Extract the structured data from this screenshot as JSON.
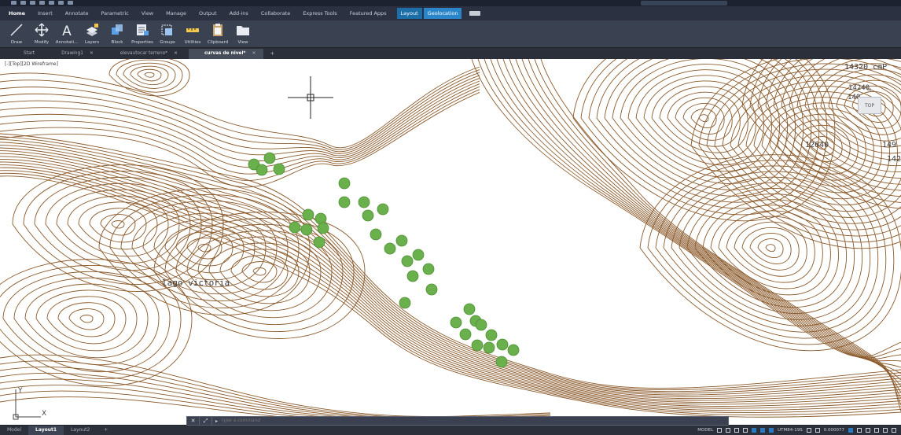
{
  "ribbon": {
    "tabs": [
      {
        "label": "Home",
        "active": true
      },
      {
        "label": "Insert"
      },
      {
        "label": "Annotate"
      },
      {
        "label": "Parametric"
      },
      {
        "label": "View"
      },
      {
        "label": "Manage"
      },
      {
        "label": "Output"
      },
      {
        "label": "Add-ins"
      },
      {
        "label": "Collaborate"
      },
      {
        "label": "Express Tools"
      },
      {
        "label": "Featured Apps"
      },
      {
        "label": "Layout",
        "contextual": true
      },
      {
        "label": "Geolocation",
        "contextual": true
      }
    ],
    "tools": [
      {
        "label": "Draw",
        "icon": "pencil-line-icon"
      },
      {
        "label": "Modify",
        "icon": "move-arrows-icon"
      },
      {
        "label": "Annotati...",
        "icon": "text-a-icon"
      },
      {
        "label": "Layers",
        "icon": "layers-icon"
      },
      {
        "label": "Block",
        "icon": "block-icon"
      },
      {
        "label": "Properties",
        "icon": "properties-icon"
      },
      {
        "label": "Groups",
        "icon": "groups-icon"
      },
      {
        "label": "Utilities",
        "icon": "measure-icon"
      },
      {
        "label": "Clipboard",
        "icon": "clipboard-icon"
      },
      {
        "label": "View",
        "icon": "folder-view-icon"
      }
    ]
  },
  "file_tabs": [
    {
      "label": "Start",
      "closable": false
    },
    {
      "label": "Drawing1",
      "closable": true
    },
    {
      "label": "elevautocar terreno*",
      "closable": true
    },
    {
      "label": "curvas de nivel*",
      "closable": true,
      "active": true
    }
  ],
  "canvas": {
    "viewport_label": "[-][Top][2D Wireframe]",
    "map_labels": [
      {
        "key": "lago",
        "text": "lago victoria"
      },
      {
        "key": "l14320",
        "text": "14320 cmP"
      },
      {
        "key": "l14240",
        "text": "14240"
      },
      {
        "key": "l140",
        "text": "140"
      },
      {
        "key": "l12640",
        "text": "12640"
      },
      {
        "key": "l149",
        "text": "149"
      },
      {
        "key": "l142",
        "text": "142"
      }
    ],
    "viewcube": {
      "north": "N",
      "face": "TOP"
    },
    "ucs": {
      "x_axis": "X",
      "y_axis": "Y"
    }
  },
  "command_line": {
    "placeholder": "Type a command",
    "close_glyph": "✕",
    "tool_glyph": "⤢"
  },
  "status_bar": {
    "layout_tabs": [
      {
        "label": "Model"
      },
      {
        "label": "Layout1",
        "active": true
      },
      {
        "label": "Layout2"
      }
    ],
    "model_label": "MODEL",
    "coord_system": "UTM84-19S",
    "scale": "0.000077"
  },
  "colors": {
    "contour": "#8b5a2b",
    "tree": "#6ab04c",
    "tree_stroke": "#4e8f35",
    "ribbon_bg": "#3a4150",
    "contextual_tab": "#1b6ea8"
  }
}
